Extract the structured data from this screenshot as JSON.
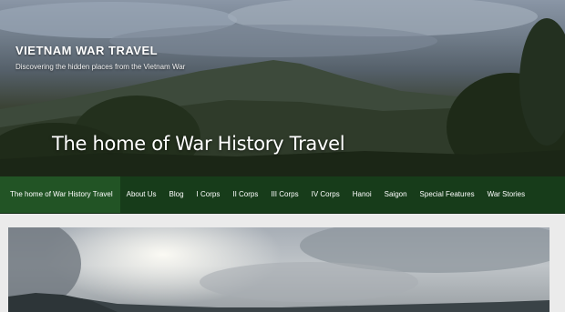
{
  "header": {
    "site_title": "VIETNAM WAR TRAVEL",
    "tagline": "Discovering the hidden places from the Vietnam War",
    "headline": "The home of War History Travel"
  },
  "nav": {
    "items": [
      {
        "label": "The home of War History Travel",
        "active": true
      },
      {
        "label": "About Us"
      },
      {
        "label": "Blog"
      },
      {
        "label": "I Corps"
      },
      {
        "label": "II Corps"
      },
      {
        "label": "III Corps"
      },
      {
        "label": "IV Corps"
      },
      {
        "label": "Hanoi"
      },
      {
        "label": "Saigon"
      },
      {
        "label": "Special Features"
      },
      {
        "label": "War Stories"
      }
    ]
  },
  "colors": {
    "nav_background": "#173c1a",
    "nav_active": "#225425",
    "page_background": "#ebebeb"
  }
}
